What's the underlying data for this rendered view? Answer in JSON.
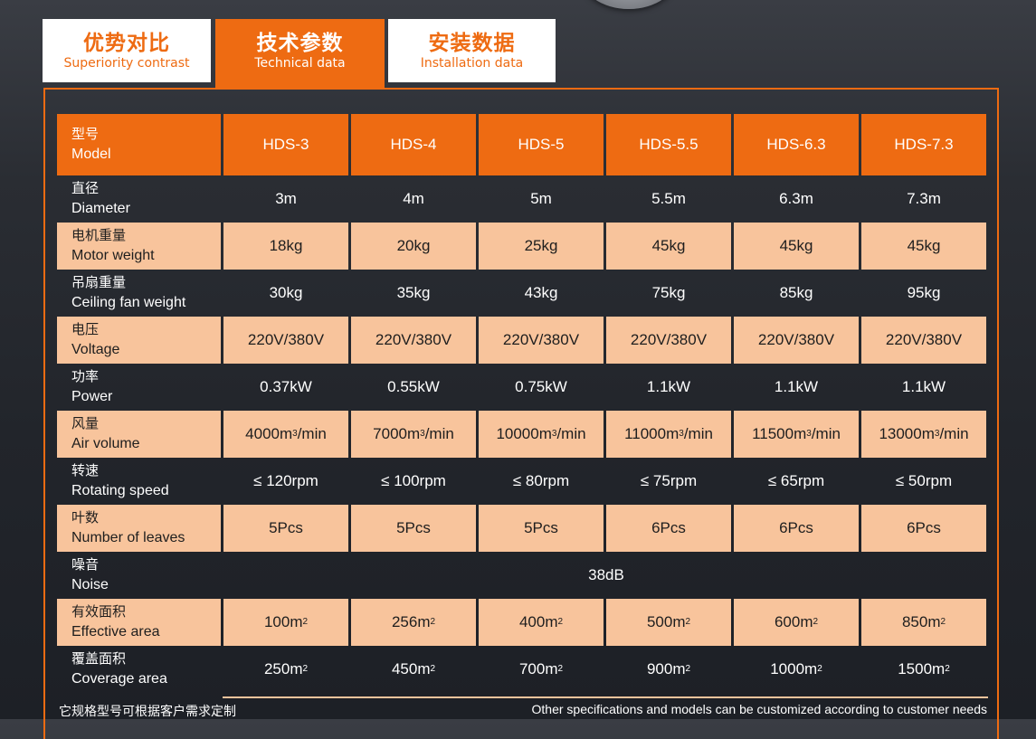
{
  "tabs": [
    {
      "zh": "优势对比",
      "en": "Superiority contrast",
      "active": false
    },
    {
      "zh": "技术参数",
      "en": "Technical data",
      "active": true
    },
    {
      "zh": "安装数据",
      "en": "Installation data",
      "active": false
    }
  ],
  "table": {
    "header": {
      "zh": "型号",
      "en": "Model",
      "models": [
        "HDS-3",
        "HDS-4",
        "HDS-5",
        "HDS-5.5",
        "HDS-6.3",
        "HDS-7.3"
      ]
    },
    "rows": [
      {
        "zh": "直径",
        "en": "Diameter",
        "values": [
          "3m",
          "4m",
          "5m",
          "5.5m",
          "6.3m",
          "7.3m"
        ]
      },
      {
        "zh": "电机重量",
        "en": "Motor weight",
        "values": [
          "18kg",
          "20kg",
          "25kg",
          "45kg",
          "45kg",
          "45kg"
        ]
      },
      {
        "zh": "吊扇重量",
        "en": "Ceiling fan weight",
        "values": [
          "30kg",
          "35kg",
          "43kg",
          "75kg",
          "85kg",
          "95kg"
        ]
      },
      {
        "zh": "电压",
        "en": "Voltage",
        "values": [
          "220V/380V",
          "220V/380V",
          "220V/380V",
          "220V/380V",
          "220V/380V",
          "220V/380V"
        ]
      },
      {
        "zh": "功率",
        "en": "Power",
        "values": [
          "0.37kW",
          "0.55kW",
          "0.75kW",
          "1.1kW",
          "1.1kW",
          "1.1kW"
        ]
      },
      {
        "zh": "风量",
        "en": "Air volume",
        "values": [
          "4000m",
          "7000m",
          "10000m",
          "11000m",
          "11500m",
          "13000m"
        ],
        "sup": "3",
        "suffix": "/min"
      },
      {
        "zh": "转速",
        "en": "Rotating speed",
        "values": [
          "≤ 120rpm",
          "≤ 100rpm",
          "≤ 80rpm",
          "≤ 75rpm",
          "≤ 65rpm",
          "≤ 50rpm"
        ]
      },
      {
        "zh": "叶数",
        "en": "Number of leaves",
        "values": [
          "5Pcs",
          "5Pcs",
          "5Pcs",
          "6Pcs",
          "6Pcs",
          "6Pcs"
        ]
      },
      {
        "zh": "噪音",
        "en": "Noise",
        "merged": "38dB"
      },
      {
        "zh": "有效面积",
        "en": "Effective area",
        "values": [
          "100m",
          "256m",
          "400m",
          "500m",
          "600m",
          "850m"
        ],
        "sup": "2",
        "suffix": ""
      },
      {
        "zh": "覆盖面积",
        "en": "Coverage area",
        "values": [
          "250m",
          "450m",
          "700m",
          "900m",
          "1000m",
          "1500m"
        ],
        "sup": "2",
        "suffix": ""
      }
    ]
  },
  "footnote": {
    "zh": "它规格型号可根据客户需求定制",
    "en": "Other specifications and models can be customized according to customer needs"
  },
  "colors": {
    "accent": "#ee6b12",
    "light_row": "#f8c49c",
    "background": "#22252b"
  }
}
